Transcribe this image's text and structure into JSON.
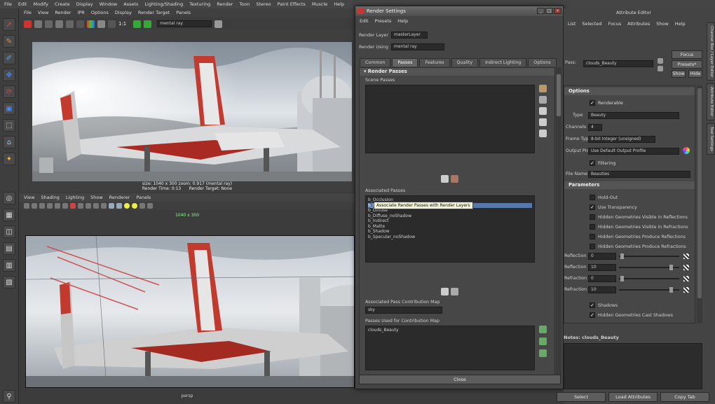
{
  "app_menu": [
    "File",
    "Edit",
    "Modify",
    "Create",
    "Display",
    "Window",
    "Assets",
    "Lighting/Shading",
    "Texturing",
    "Render",
    "Toon",
    "Stereo",
    "Paint Effects",
    "Muscle",
    "Help"
  ],
  "render_view": {
    "menu": [
      "File",
      "View",
      "Render",
      "IPR",
      "Options",
      "Display",
      "Render Target",
      "Panels"
    ],
    "ratio": "1:1",
    "renderer": "mental ray",
    "size_line": "size: 1040 x 300 zoom: 0.917 (mental ray)",
    "render_time": "Render Time: 0:13",
    "render_target": "Render Target: None"
  },
  "persp_view": {
    "menu": [
      "View",
      "Shading",
      "Lighting",
      "Show",
      "Renderer",
      "Panels"
    ],
    "resolution": "1040 x 300",
    "camera": "persp"
  },
  "render_settings": {
    "title": "Render Settings",
    "menu": [
      "Edit",
      "Presets",
      "Help"
    ],
    "render_layer_label": "Render Layer",
    "render_layer_value": "masterLayer",
    "render_using_label": "Render Using",
    "render_using_value": "mental ray",
    "tabs": [
      "Common",
      "Passes",
      "Features",
      "Quality",
      "Indirect Lighting",
      "Options"
    ],
    "active_tab": "Passes",
    "section_title": "Render Passes",
    "scene_passes_label": "Scene Passes",
    "associated_passes_label": "Associated Passes",
    "associated_passes": [
      "b_Occlusion",
      "b_Beauty",
      "b_Diffuse",
      "b_Diffuse_noShadow",
      "b_Indirect",
      "b_Matte",
      "b_Shadow",
      "b_Specular_noShadow"
    ],
    "tooltip": "Associate Render Passes with Render Layers",
    "contribution_map_label": "Associated Pass Contribution Map",
    "contribution_map_value": "sky",
    "passes_used_label": "Passes Used for Contribution Map",
    "passes_used": [
      "clouds_Beauty"
    ],
    "close_label": "Close"
  },
  "attribute_editor": {
    "title": "Attribute Editor",
    "menu": [
      "List",
      "Selected",
      "Focus",
      "Attributes",
      "Show",
      "Help"
    ],
    "name_label": "Pass:",
    "name_value": "clouds_Beauty",
    "focus_label": "Focus",
    "presets_label": "Presets*",
    "show_label": "Show",
    "hide_label": "Hide",
    "options_section": "Options",
    "renderable_label": "Renderable",
    "type_label": "Type",
    "type_value": "Beauty",
    "channels_label": "Channels",
    "channels_value": "4",
    "frame_type_label": "Frame Type",
    "frame_type_value": "8-bit Integer (unsigned)",
    "output_profile_label": "Output Profile",
    "output_profile_value": "Use Default Output Profile",
    "filtering_label": "Filtering",
    "file_name_label": "File Name",
    "file_name_value": "Beauties",
    "parameters_section": "Parameters",
    "checkboxes": [
      {
        "label": "Hold-Out",
        "checked": false
      },
      {
        "label": "Use Transparency",
        "checked": true
      },
      {
        "label": "Hidden Geometries Visible in Reflections",
        "checked": false
      },
      {
        "label": "Hidden Geometries Visible in Refractions",
        "checked": false
      },
      {
        "label": "Hidden Geometries Produce Reflections",
        "checked": false
      },
      {
        "label": "Hidden Geometries Produce Refractions",
        "checked": false
      }
    ],
    "levels": [
      {
        "label": "Reflection Level",
        "value": "0"
      },
      {
        "label": "Reflection Level",
        "value": "10"
      },
      {
        "label": "Refraction Level",
        "value": "0"
      },
      {
        "label": "Refraction Level",
        "value": "10"
      }
    ],
    "bottom_checkboxes": [
      {
        "label": "Shadows",
        "checked": true
      },
      {
        "label": "Hidden Geometries Cast Shadows",
        "checked": true
      }
    ],
    "notes_label": "Notes: clouds_Beauty",
    "select_label": "Select",
    "load_attributes_label": "Load Attributes",
    "copy_tab_label": "Copy Tab",
    "side_tabs": [
      "Channel Box / Layer Editor",
      "Attribute Editor",
      "Tool Settings"
    ]
  }
}
